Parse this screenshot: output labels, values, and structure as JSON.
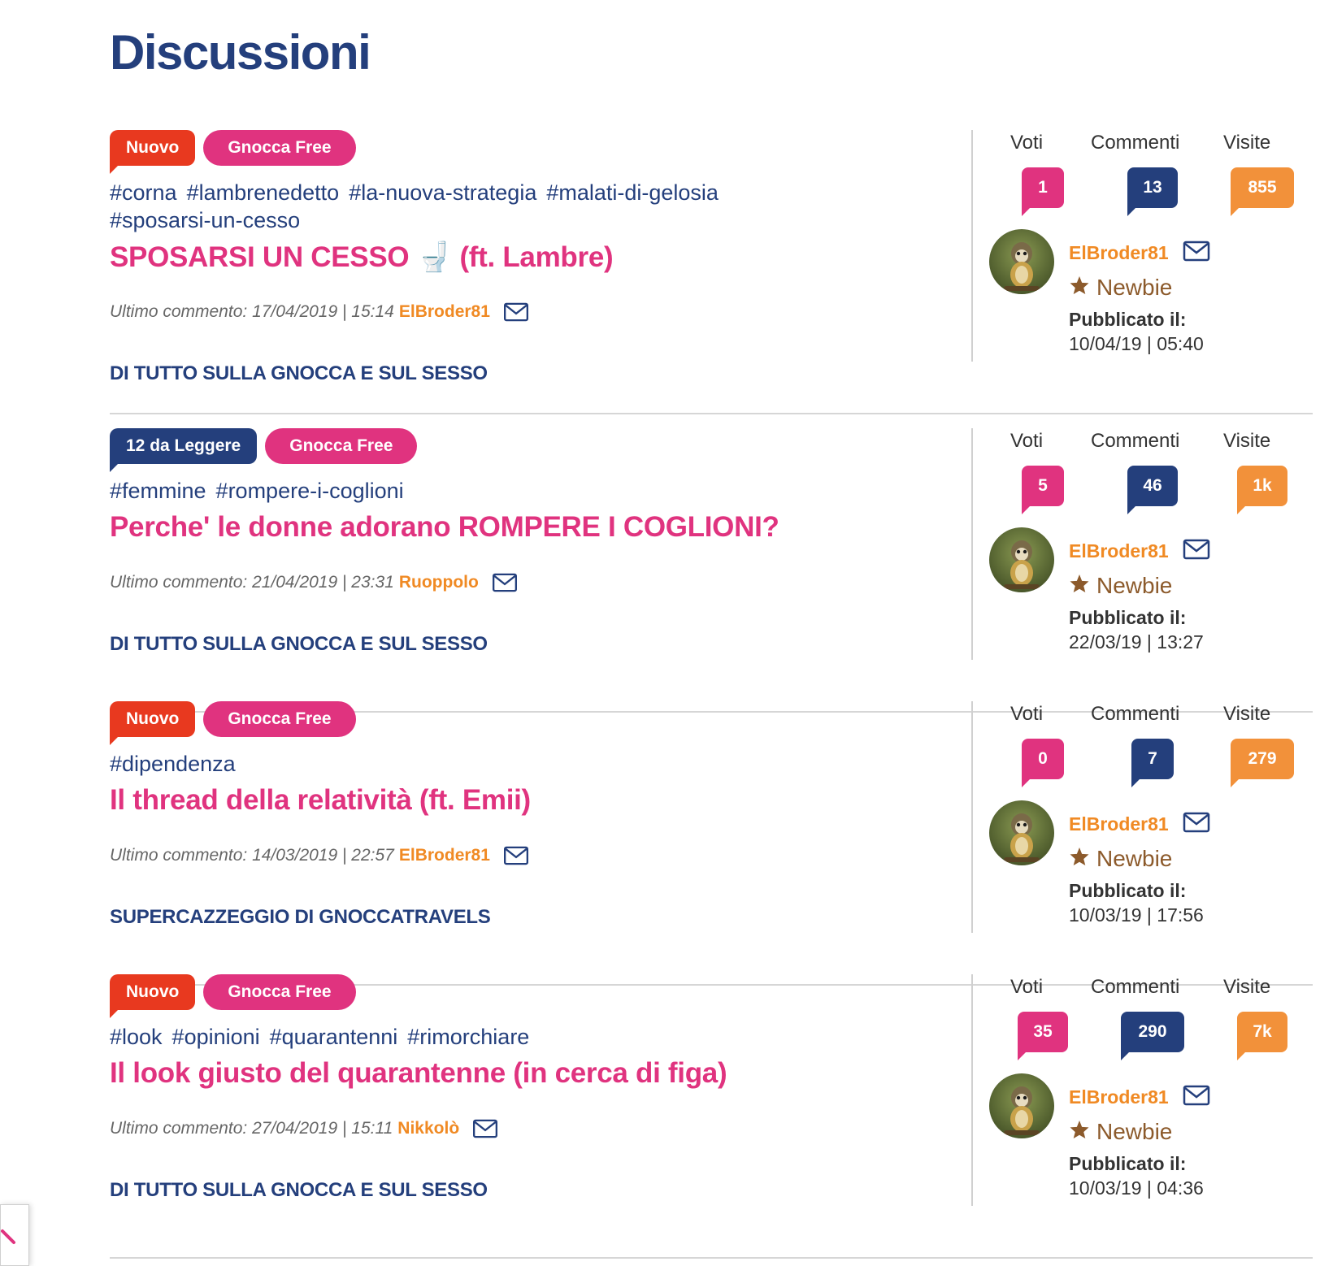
{
  "page": {
    "title": "Discussioni"
  },
  "labels": {
    "last_comment_prefix": "Ultimo commento:",
    "published_prefix": "Pubblicato il:"
  },
  "stats_headers": {
    "votes": "Voti",
    "comments": "Commenti",
    "visits": "Visite"
  },
  "colors": {
    "navy": "#243f7c",
    "pink": "#e0337f",
    "orange": "#f2913a",
    "red": "#e8391f"
  },
  "threads": [
    {
      "badges": [
        {
          "type": "nuovo",
          "text": "Nuovo"
        },
        {
          "type": "free",
          "text": "Gnocca Free"
        }
      ],
      "tags": [
        "#corna",
        "#lambrenedetto",
        "#la-nuova-strategia",
        "#malati-di-gelosia",
        "#sposarsi-un-cesso"
      ],
      "title": "SPOSARSI UN CESSO 🚽 (ft. Lambre)",
      "last_comment": {
        "date": "17/04/2019",
        "time": "15:14",
        "user": "ElBroder81"
      },
      "category": "DI TUTTO SULLA GNOCCA E SUL SESSO",
      "votes": "1",
      "comments": "13",
      "visits": "855",
      "author": "ElBroder81",
      "rank": "Newbie",
      "published": "10/04/19 | 05:40"
    },
    {
      "badges": [
        {
          "type": "toread",
          "text": "12 da Leggere"
        },
        {
          "type": "free",
          "text": "Gnocca Free"
        }
      ],
      "tags": [
        "#femmine",
        "#rompere-i-coglioni"
      ],
      "title": "Perche' le donne adorano ROMPERE I COGLIONI?",
      "last_comment": {
        "date": "21/04/2019",
        "time": "23:31",
        "user": "Ruoppolo"
      },
      "category": "DI TUTTO SULLA GNOCCA E SUL SESSO",
      "votes": "5",
      "comments": "46",
      "visits": "1k",
      "author": "ElBroder81",
      "rank": "Newbie",
      "published": "22/03/19 | 13:27"
    },
    {
      "badges": [
        {
          "type": "nuovo",
          "text": "Nuovo"
        },
        {
          "type": "free",
          "text": "Gnocca Free"
        }
      ],
      "tags": [
        "#dipendenza"
      ],
      "title": "Il thread della relatività (ft. Emii)",
      "last_comment": {
        "date": "14/03/2019",
        "time": "22:57",
        "user": "ElBroder81"
      },
      "category": "SUPERCAZZEGGIO DI GNOCCATRAVELS",
      "votes": "0",
      "comments": "7",
      "visits": "279",
      "author": "ElBroder81",
      "rank": "Newbie",
      "published": "10/03/19 | 17:56"
    },
    {
      "badges": [
        {
          "type": "nuovo",
          "text": "Nuovo"
        },
        {
          "type": "free",
          "text": "Gnocca Free"
        }
      ],
      "tags": [
        "#look",
        "#opinioni",
        "#quarantenni",
        "#rimorchiare"
      ],
      "title": "Il look giusto del quarantenne (in cerca di figa)",
      "last_comment": {
        "date": "27/04/2019",
        "time": "15:11",
        "user": "Nikkolò"
      },
      "category": "DI TUTTO SULLA GNOCCA E SUL SESSO",
      "votes": "35",
      "comments": "290",
      "visits": "7k",
      "author": "ElBroder81",
      "rank": "Newbie",
      "published": "10/03/19 | 04:36"
    }
  ]
}
